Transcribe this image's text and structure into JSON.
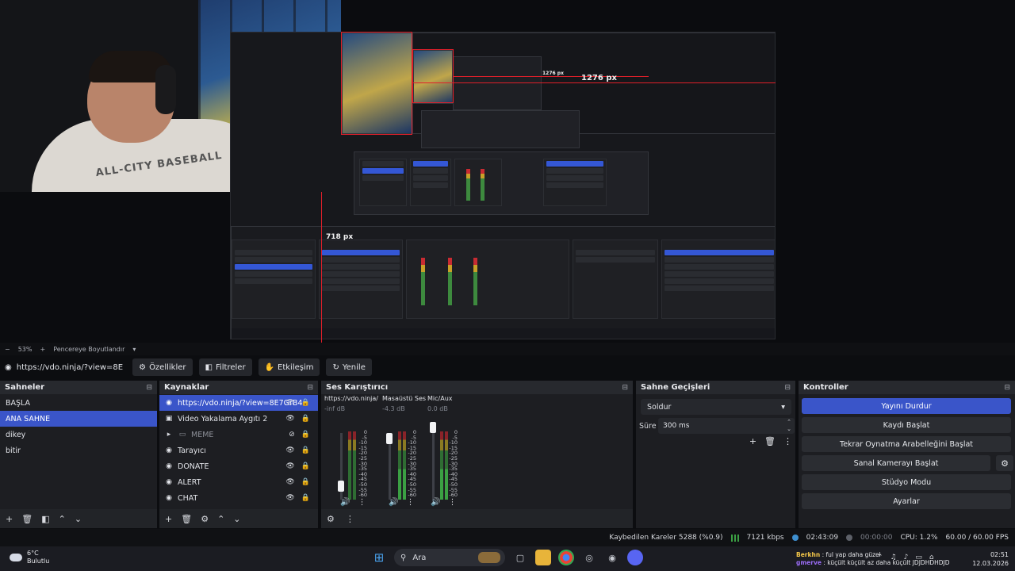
{
  "window": {
    "controls": [
      "—",
      "▢",
      "✕"
    ]
  },
  "preview": {
    "overlay_width_label": "1276 px",
    "overlay_height_label": "718 px",
    "overlay_small_label": "1276 px",
    "shirt_text": "ALL-CITY BASEBALL"
  },
  "zoom": {
    "minus": "−",
    "percent": "53%",
    "plus": "+",
    "mode": "Pencereye Boyutlandır"
  },
  "source_toolbar": {
    "source_name": "https://vdo.ninja/?view=8E",
    "properties": "Özellikler",
    "filters": "Filtreler",
    "interact": "Etkileşim",
    "refresh": "Yenile"
  },
  "scenes": {
    "title": "Sahneler",
    "items": [
      "BAŞLA",
      "ANA SAHNE",
      "dikey",
      "bitir"
    ],
    "selected": 1
  },
  "sources": {
    "title": "Kaynaklar",
    "items": [
      {
        "label": "https://vdo.ninja/?view=8E7GrB4",
        "icon": "globe-icon"
      },
      {
        "label": "Video Yakalama Aygıtı 2",
        "icon": "camera-icon"
      },
      {
        "label": "MEME",
        "icon": "folder-icon"
      },
      {
        "label": "Tarayıcı",
        "icon": "globe-icon"
      },
      {
        "label": "DONATE",
        "icon": "globe-icon"
      },
      {
        "label": "ALERT",
        "icon": "globe-icon"
      },
      {
        "label": "CHAT",
        "icon": "globe-icon"
      }
    ]
  },
  "mixer": {
    "title": "Ses Karıştırıcı",
    "channels": [
      {
        "name": "https://vdo.ninja/?v",
        "db": "-inf dB",
        "level": 0.0
      },
      {
        "name": "Masaüstü Ses",
        "db": "-4.3 dB",
        "level": 0.95
      },
      {
        "name": "Mic/Aux",
        "db": "0.0 dB",
        "level": 1.0
      }
    ],
    "scale": [
      "0",
      "-5",
      "-10",
      "-15",
      "-20",
      "-25",
      "-30",
      "-35",
      "-40",
      "-45",
      "-50",
      "-55",
      "-60"
    ]
  },
  "transitions": {
    "title": "Sahne Geçişleri",
    "selected": "Soldur",
    "duration_label": "Süre",
    "duration_value": "300 ms"
  },
  "controls": {
    "title": "Kontroller",
    "stop_stream": "Yayını Durdur",
    "start_recording": "Kaydı Başlat",
    "replay_buffer": "Tekrar Oynatma Arabelleğini Başlat",
    "virtual_camera": "Sanal Kamerayı Başlat",
    "studio_mode": "Stüdyo Modu",
    "settings": "Ayarlar"
  },
  "status": {
    "dropped_frames": "Kaybedilen Kareler 5288 (%0.9)",
    "bitrate": "7121 kbps",
    "stream_time": "02:43:09",
    "record_time": "00:00:00",
    "cpu": "CPU: 1.2%",
    "fps": "60.00 / 60.00 FPS"
  },
  "taskbar": {
    "weather_temp": "6°C",
    "weather_desc": "Bulutlu",
    "search_placeholder": "Ara",
    "chat_line1_user": "Berkhn",
    "chat_line1_text": ": ful yap daha güzel",
    "chat_line2_user": "gmerve",
    "chat_line2_text": ": küçült küçült az daha küçült JDJDHDHDJD",
    "time": "02:51",
    "date": "12.03.2026"
  },
  "colors": {
    "accent": "#3a55c9",
    "overlay_red": "#e01f2a",
    "meter_green": "#3ba043"
  }
}
